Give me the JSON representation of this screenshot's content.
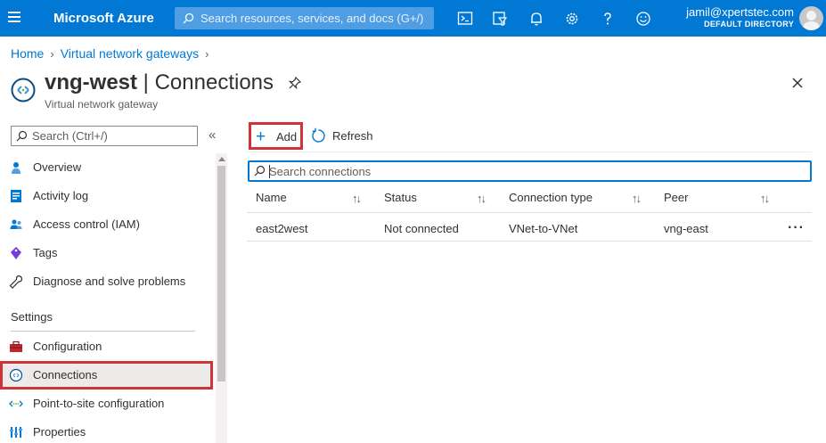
{
  "topbar": {
    "brand": "Microsoft Azure",
    "search_placeholder": "Search resources, services, and docs (G+/)",
    "icons": [
      "cloud-shell-icon",
      "directory-filter-icon",
      "notifications-icon",
      "settings-icon",
      "help-icon",
      "feedback-icon"
    ],
    "user_email": "jamil@xpertstec.com",
    "user_directory": "DEFAULT DIRECTORY",
    "color": "#0078d4"
  },
  "breadcrumb": {
    "items": [
      "Home",
      "Virtual network gateways"
    ]
  },
  "header": {
    "resource_name": "vng-west",
    "separator": " | ",
    "page_name": "Connections",
    "subtitle": "Virtual network gateway"
  },
  "menu": {
    "search_placeholder": "Search (Ctrl+/)",
    "collapse_glyph": "«",
    "items": [
      {
        "label": "Overview",
        "icon": "overview-icon"
      },
      {
        "label": "Activity log",
        "icon": "activity-log-icon"
      },
      {
        "label": "Access control (IAM)",
        "icon": "iam-icon"
      },
      {
        "label": "Tags",
        "icon": "tag-icon"
      },
      {
        "label": "Diagnose and solve problems",
        "icon": "wrench-icon"
      }
    ],
    "section_title": "Settings",
    "settings_items": [
      {
        "label": "Configuration",
        "icon": "toolbox-icon"
      },
      {
        "label": "Connections",
        "icon": "connections-icon",
        "active": true
      },
      {
        "label": "Point-to-site configuration",
        "icon": "point-to-site-icon"
      },
      {
        "label": "Properties",
        "icon": "properties-icon"
      }
    ]
  },
  "commands": {
    "add_label": "Add",
    "refresh_label": "Refresh"
  },
  "content": {
    "search_placeholder": "Search connections",
    "table": {
      "columns": [
        "Name",
        "Status",
        "Connection type",
        "Peer"
      ],
      "sort_glyph": "↑↓",
      "rows": [
        {
          "name": "east2west",
          "status": "Not connected",
          "type": "VNet-to-VNet",
          "peer": "vng-east",
          "more": "···"
        }
      ]
    }
  },
  "colors": {
    "accent": "#0078d4",
    "highlight_box": "#d13438"
  }
}
